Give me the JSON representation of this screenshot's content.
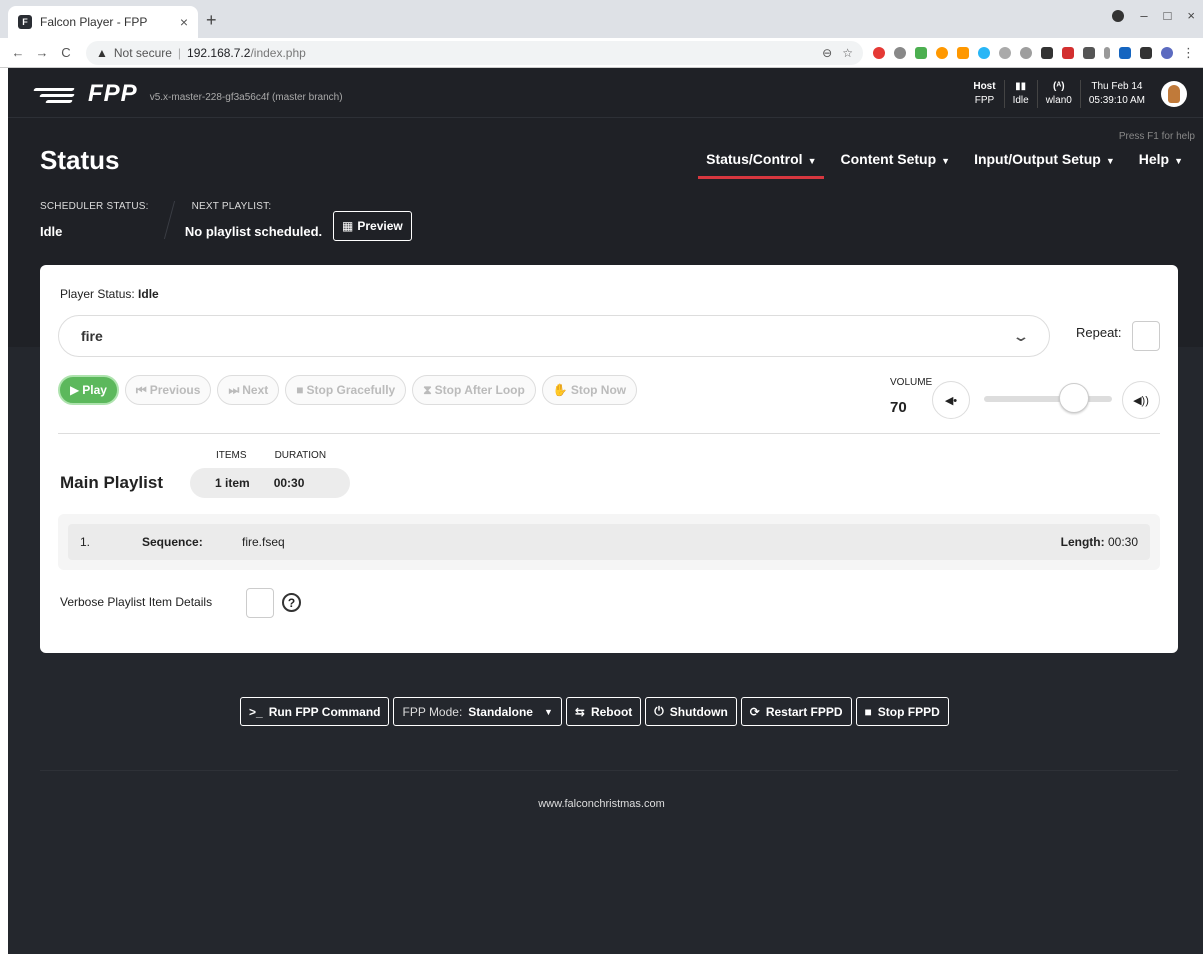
{
  "browser": {
    "tab_title": "Falcon Player - FPP",
    "tab_close": "×",
    "new_tab": "+",
    "not_secure": "Not secure",
    "host": "192.168.7.2",
    "path": "/index.php",
    "warn_icon": "▲",
    "back": "←",
    "forward": "→",
    "reload": "C",
    "zoom": "⊖",
    "star": "☆",
    "win_min": "–",
    "win_max": "□",
    "win_close": "×"
  },
  "header": {
    "logo": "FPP",
    "version": "v5.x-master-228-gf3a56c4f (master branch)",
    "host_label": "Host",
    "host_value": "FPP",
    "status_icon": "▮▮",
    "status_value": "Idle",
    "wifi_icon": "(ᴬ)",
    "wifi_value": "wlan0",
    "date": "Thu Feb 14",
    "time": "05:39:10 AM"
  },
  "top": {
    "help_hint": "Press F1 for help",
    "page_title": "Status",
    "menu": [
      {
        "label": "Status/Control"
      },
      {
        "label": "Content Setup"
      },
      {
        "label": "Input/Output Setup"
      },
      {
        "label": "Help"
      }
    ],
    "scheduler_label": "SCHEDULER STATUS:",
    "scheduler_value": "Idle",
    "next_label": "NEXT PLAYLIST:",
    "next_value": "No playlist scheduled.",
    "preview_label": "Preview"
  },
  "player": {
    "status_label": "Player Status:",
    "status_value": "Idle",
    "selected_playlist": "fire",
    "repeat_label": "Repeat:",
    "buttons": {
      "play": "Play",
      "previous": "Previous",
      "next": "Next",
      "stop_gracefully": "Stop Gracefully",
      "stop_after_loop": "Stop After Loop",
      "stop_now": "Stop Now"
    },
    "volume_label": "VOLUME",
    "volume": 70
  },
  "playlist": {
    "title": "Main Playlist",
    "items_label": "ITEMS",
    "duration_label": "DURATION",
    "items_value": "1 item",
    "duration_value": "00:30",
    "rows": [
      {
        "num": "1.",
        "type": "Sequence:",
        "file": "fire.fseq",
        "length_label": "Length:",
        "length": "00:30"
      }
    ],
    "verbose_label": "Verbose Playlist Item Details",
    "help_icon": "?"
  },
  "bottom": {
    "run_command": "Run FPP Command",
    "mode_label": "FPP Mode:",
    "mode_value": "Standalone",
    "reboot": "Reboot",
    "shutdown": "Shutdown",
    "restart": "Restart FPPD",
    "stop": "Stop FPPD"
  },
  "footer": {
    "link": "www.falconchristmas.com"
  },
  "colors": {
    "accent_red": "#d7373f",
    "play_green": "#5cb85c",
    "background": "#1f2126"
  }
}
